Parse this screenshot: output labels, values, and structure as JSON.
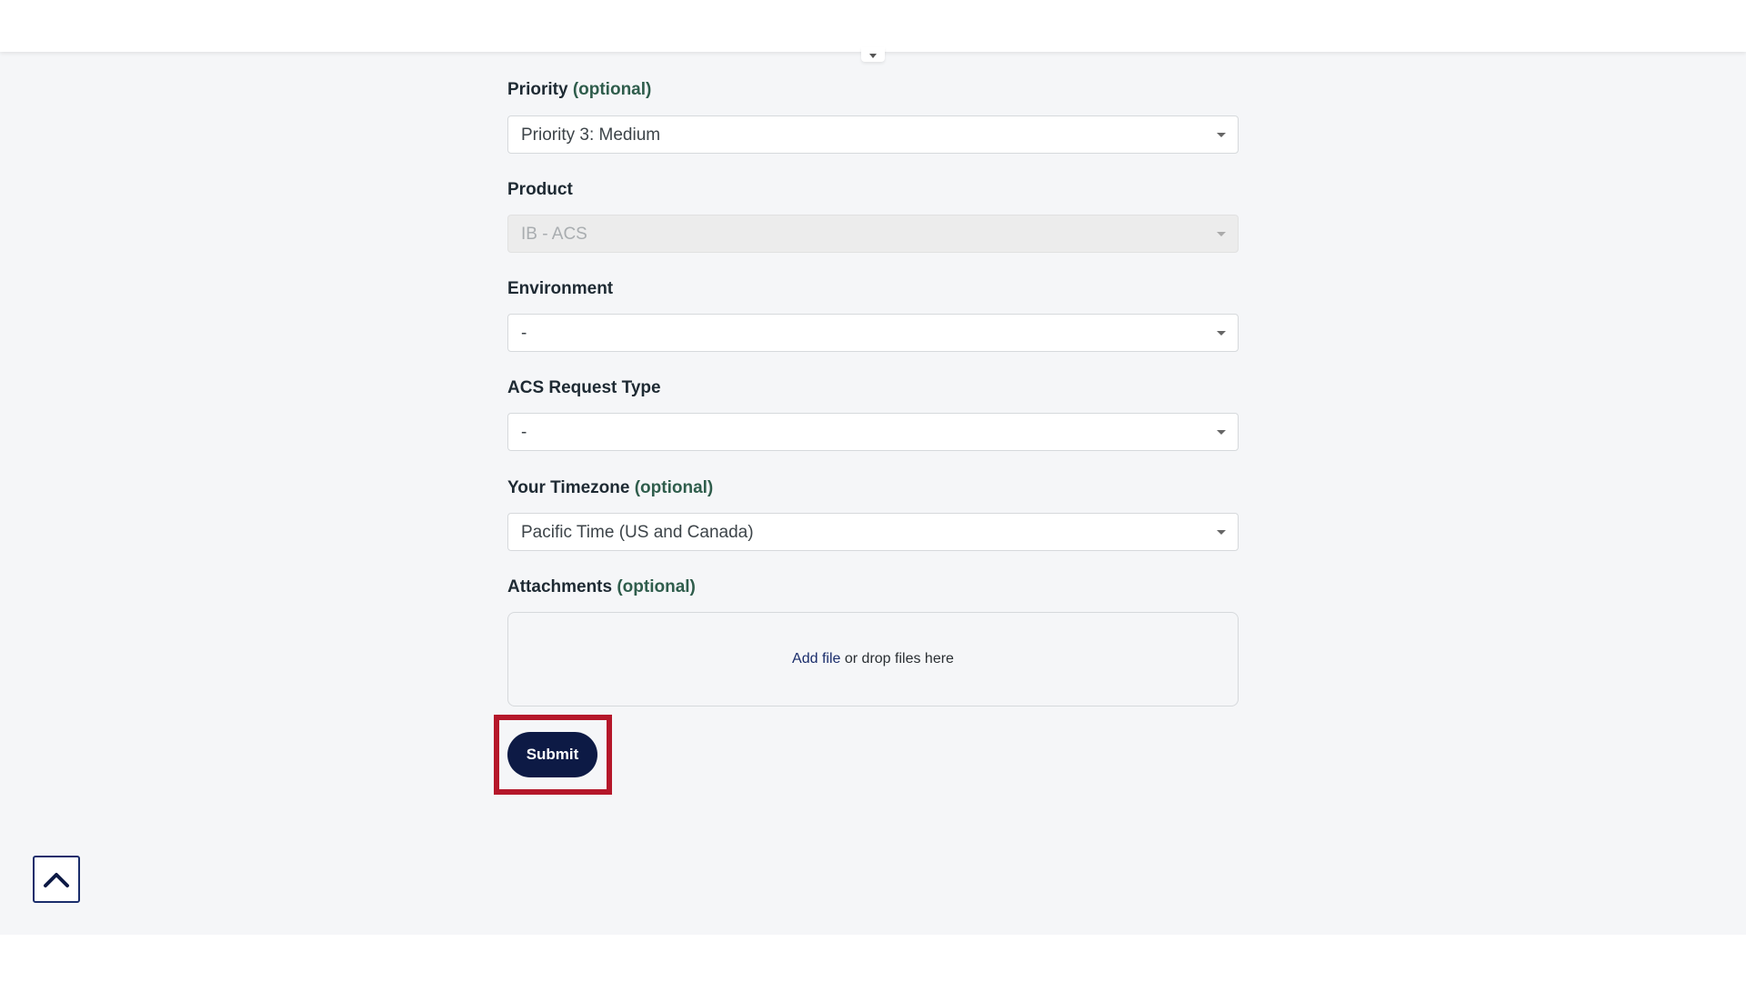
{
  "form": {
    "priority": {
      "label": "Priority",
      "optional": "(optional)",
      "value": "Priority 3: Medium"
    },
    "product": {
      "label": "Product",
      "value": "IB - ACS"
    },
    "environment": {
      "label": "Environment",
      "value": "-"
    },
    "acs_request_type": {
      "label": "ACS Request Type",
      "value": "-"
    },
    "timezone": {
      "label": "Your Timezone",
      "optional": "(optional)",
      "value": "Pacific Time (US and Canada)"
    },
    "attachments": {
      "label": "Attachments",
      "optional": "(optional)",
      "add_file": "Add file",
      "drop_text": "or drop files here"
    },
    "submit_label": "Submit"
  },
  "colors": {
    "submit_button": "#0d1a45",
    "highlight": "#b5172a",
    "optional_text": "#2f5d4c",
    "page_background": "#f5f6f8"
  },
  "icons": {
    "back_to_top": "chevron-up-icon",
    "dropdown": "caret-down-icon"
  }
}
